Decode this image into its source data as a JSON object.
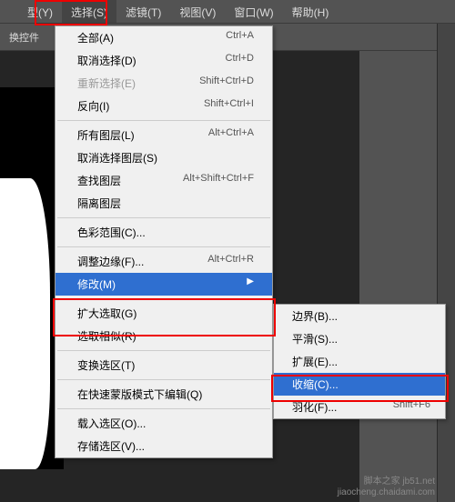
{
  "menubar": {
    "items": [
      {
        "label": "型(Y)"
      },
      {
        "label": "选择(S)"
      },
      {
        "label": "滤镜(T)"
      },
      {
        "label": "视图(V)"
      },
      {
        "label": "窗口(W)"
      },
      {
        "label": "帮助(H)"
      }
    ]
  },
  "toolbar": {
    "label": "换控件"
  },
  "selectMenu": {
    "g1": [
      {
        "label": "全部(A)",
        "sc": "Ctrl+A"
      },
      {
        "label": "取消选择(D)",
        "sc": "Ctrl+D"
      },
      {
        "label": "重新选择(E)",
        "sc": "Shift+Ctrl+D",
        "disabled": true
      },
      {
        "label": "反向(I)",
        "sc": "Shift+Ctrl+I"
      }
    ],
    "g2": [
      {
        "label": "所有图层(L)",
        "sc": "Alt+Ctrl+A"
      },
      {
        "label": "取消选择图层(S)",
        "sc": ""
      },
      {
        "label": "查找图层",
        "sc": "Alt+Shift+Ctrl+F"
      },
      {
        "label": "隔离图层",
        "sc": ""
      }
    ],
    "g3": [
      {
        "label": "色彩范围(C)...",
        "sc": ""
      }
    ],
    "g4": [
      {
        "label": "调整边缘(F)...",
        "sc": "Alt+Ctrl+R"
      },
      {
        "label": "修改(M)",
        "sc": "",
        "sub": true,
        "hl": true
      }
    ],
    "g5": [
      {
        "label": "扩大选取(G)",
        "sc": ""
      },
      {
        "label": "选取相似(R)",
        "sc": ""
      }
    ],
    "g6": [
      {
        "label": "变换选区(T)",
        "sc": ""
      }
    ],
    "g7": [
      {
        "label": "在快速蒙版模式下编辑(Q)",
        "sc": ""
      }
    ],
    "g8": [
      {
        "label": "载入选区(O)...",
        "sc": ""
      },
      {
        "label": "存储选区(V)...",
        "sc": ""
      }
    ]
  },
  "modifySubmenu": {
    "items": [
      {
        "label": "边界(B)...",
        "sc": ""
      },
      {
        "label": "平滑(S)...",
        "sc": ""
      },
      {
        "label": "扩展(E)...",
        "sc": ""
      },
      {
        "label": "收缩(C)...",
        "sc": "",
        "hl": true
      },
      {
        "label": "羽化(F)...",
        "sc": "Shift+F6"
      }
    ]
  },
  "watermark": {
    "line1": "脚本之家 jb51.net",
    "line2": "jiaocheng.chaidami.com"
  }
}
